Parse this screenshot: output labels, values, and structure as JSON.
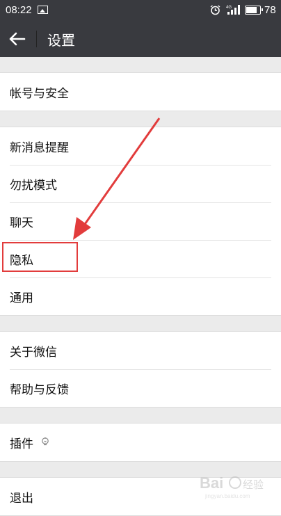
{
  "status_bar": {
    "time": "08:22",
    "battery_level": "78",
    "battery_fraction": 0.78,
    "icons": [
      "image-icon",
      "alarm-icon",
      "signal-icon",
      "battery-icon"
    ]
  },
  "header": {
    "title": "设置",
    "back_icon": "arrow-left-icon",
    "background": "#393a3f"
  },
  "groups": [
    {
      "items": [
        {
          "label": "帐号与安全"
        }
      ]
    },
    {
      "items": [
        {
          "label": "新消息提醒"
        },
        {
          "label": "勿扰模式"
        },
        {
          "label": "聊天"
        },
        {
          "label": "隐私"
        },
        {
          "label": "通用"
        }
      ]
    },
    {
      "items": [
        {
          "label": "关于微信"
        },
        {
          "label": "帮助与反馈"
        }
      ]
    },
    {
      "items": [
        {
          "label": "插件",
          "icon": "plugin-bulb-icon"
        }
      ]
    },
    {
      "items": [
        {
          "label": "退出"
        }
      ]
    }
  ],
  "annotation": {
    "highlight_color": "#e23c3c",
    "target": "隐私"
  },
  "watermark": "Baidu 经验"
}
